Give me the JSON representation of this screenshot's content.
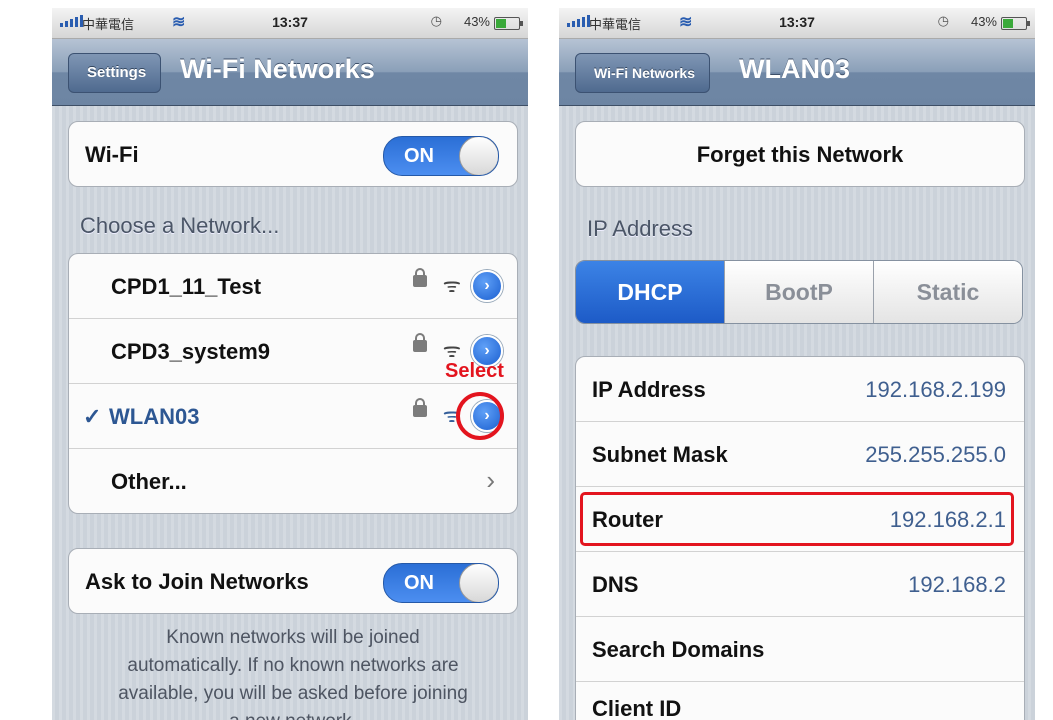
{
  "status_bar": {
    "carrier": "中華電信",
    "time": "13:37",
    "battery": "43%",
    "battery_level": 0.43
  },
  "left": {
    "back_label": "Settings",
    "title": "Wi-Fi Networks",
    "wifi_label": "Wi-Fi",
    "wifi_toggle": "ON",
    "choose_header": "Choose a Network...",
    "networks": [
      "CPD1_11_Test",
      "CPD3_system9",
      "WLAN03"
    ],
    "checkmark": "✓",
    "other_label": "Other...",
    "select_annotation": "Select",
    "ask_label": "Ask to Join Networks",
    "ask_toggle": "ON",
    "footer_lines": [
      "Known networks will be joined",
      "automatically.  If no known networks are",
      "available, you will be asked before joining",
      "a new network."
    ]
  },
  "right": {
    "back_label": "Wi-Fi Networks",
    "title": "WLAN03",
    "forget_label": "Forget this Network",
    "ip_header": "IP Address",
    "segments": [
      "DHCP",
      "BootP",
      "Static"
    ],
    "active_segment": "DHCP",
    "rows": [
      {
        "label": "IP Address",
        "value": "192.168.2.199"
      },
      {
        "label": "Subnet Mask",
        "value": "255.255.255.0"
      },
      {
        "label": "Router",
        "value": "192.168.2.1"
      },
      {
        "label": "DNS",
        "value": "192.168.2"
      },
      {
        "label": "Search Domains",
        "value": ""
      },
      {
        "label": "Client ID",
        "value": ""
      }
    ]
  },
  "colors": {
    "accent_blue": "#2b6fd6",
    "annotation_red": "#e3141e",
    "navbar": "#7f94b0"
  },
  "icons": [
    "signal-bars-icon",
    "wifi-icon",
    "lock-icon",
    "detail-disclosure-icon",
    "chevron-right-icon",
    "checkmark-icon"
  ]
}
